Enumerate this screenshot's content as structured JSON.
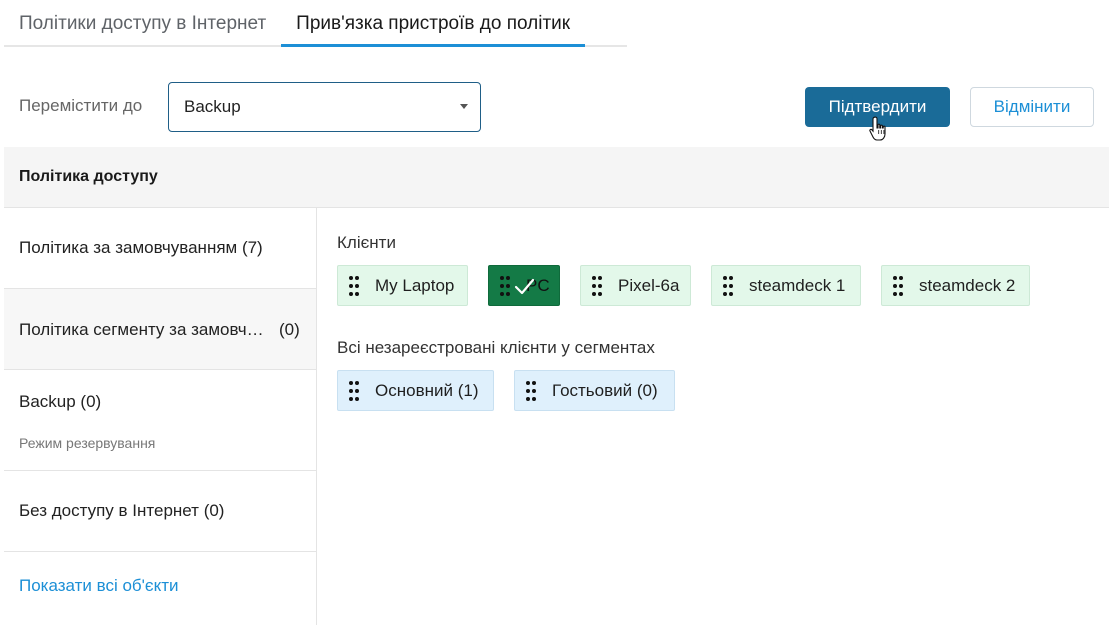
{
  "tabs": [
    {
      "label": "Політики доступу в Інтернет",
      "active": false
    },
    {
      "label": "Прив'язка пристроїв до політик",
      "active": true
    }
  ],
  "toolbar": {
    "move_to_label": "Перемістити до",
    "select_value": "Backup",
    "confirm_label": "Підтвердити",
    "cancel_label": "Відмінити"
  },
  "section": {
    "header": "Політика доступу"
  },
  "policies": [
    {
      "label": "Політика за замовчуванням (7)"
    },
    {
      "label": "Політика сегменту за замовч…",
      "count": "(0)"
    },
    {
      "label": "Backup (0)",
      "sublabel": "Режим резервування"
    },
    {
      "label": "Без доступу в Інтернет (0)"
    }
  ],
  "show_all_label": "Показати всі об'єкти",
  "clients": {
    "title": "Клієнти",
    "items": [
      {
        "label": "My Laptop"
      },
      {
        "label": "PC",
        "selected": true
      },
      {
        "label": "Pixel-6a"
      },
      {
        "label": "steamdeck 1"
      },
      {
        "label": "steamdeck 2"
      }
    ]
  },
  "segments": {
    "title": "Всі незареєстровані клієнти у сегментах",
    "items": [
      {
        "label": "Основний (1)"
      },
      {
        "label": "Гостьовий (0)"
      }
    ]
  },
  "colors": {
    "accent": "#1c8fd6",
    "primary_button": "#1a6b98",
    "client_chip": "#e3f8ea",
    "selected_chip": "#147a46",
    "segment_chip": "#dff0fc"
  },
  "icons": [
    "drag-handle-icon",
    "checkmark-icon",
    "caret-down-icon",
    "hand-cursor-icon"
  ]
}
